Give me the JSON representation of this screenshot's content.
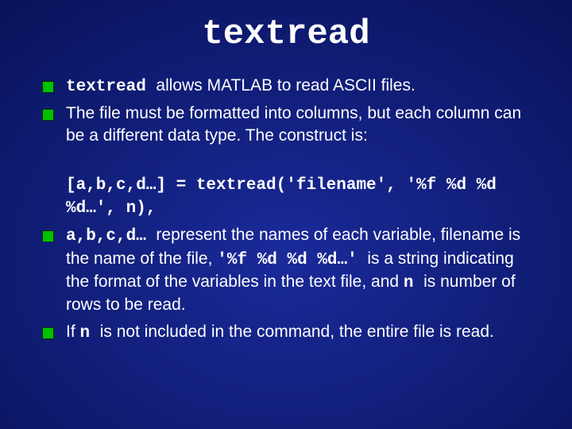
{
  "title": "textread",
  "bullets": {
    "b1": {
      "code1": "textread ",
      "text1": "allows MATLAB to read ASCII files."
    },
    "b2": {
      "text1": "The file must be formatted into columns, but each column can be a different data type. The construct is:"
    },
    "code_block": {
      "line1": "[a,b,c,d…] = textread('filename', '%f %d %d %d…', n),"
    },
    "b3": {
      "code1": "a,b,c,d… ",
      "text1": "represent the names of each variable, filename is the name of the file, ",
      "code2": "'%f %d %d %d…' ",
      "text2": "is a string indicating the format of the variables in the text file, and ",
      "code3": "n ",
      "text3": "is number of rows to be read."
    },
    "b4": {
      "text1": "If ",
      "code1": "n ",
      "text2": "is not included in the command, the entire file is read."
    }
  }
}
